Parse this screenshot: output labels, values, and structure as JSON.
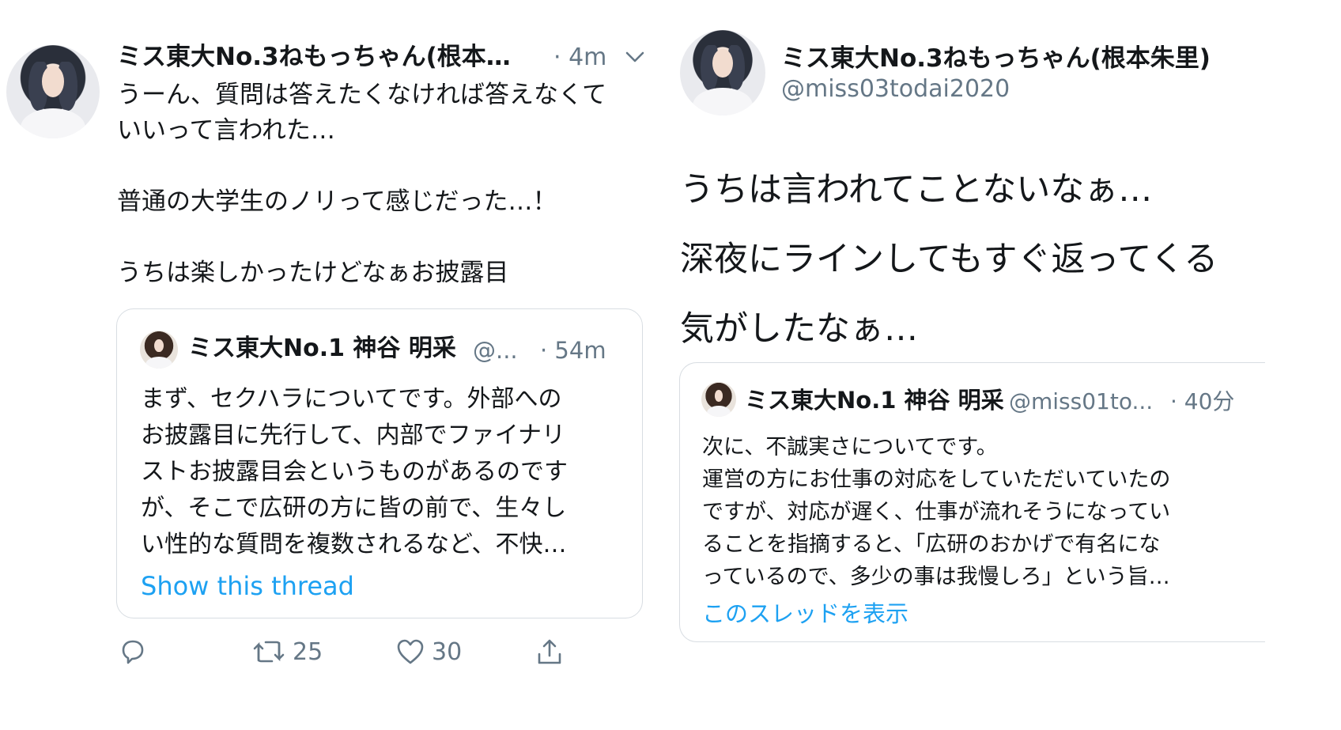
{
  "left_tweet": {
    "author_name": "ミス東大No.3ねもっちゃん(根本…",
    "time": "· 4m",
    "body": "うーん、質問は答えたくなければ答えなくて\nいいって言われた…\n\n普通の大学生のノリって感じだった…！\n\nうちは楽しかったけどなぁお披露目",
    "quoted": {
      "author_name": "ミス東大No.1 神谷 明采",
      "handle": "@...",
      "time": "· 54m",
      "body": "まず、セクハラについてです。外部への\nお披露目に先行して、内部でファイナリ\nストお披露目会というものがあるのです\nが、そこで広研の方に皆の前で、生々し\nい性的な質問を複数されるなど、不快…",
      "link": "Show this thread"
    },
    "actions": {
      "retweet_count": "25",
      "like_count": "30"
    }
  },
  "right_tweet": {
    "author_name": "ミス東大No.3ねもっちゃん(根本朱里)",
    "handle": "@miss03todai2020",
    "body": "うちは言われてことないなぁ…\n深夜にラインしてもすぐ返ってくる\n気がしたなぁ…",
    "quoted": {
      "author_name": "ミス東大No.1 神谷 明采",
      "handle": "@miss01to...",
      "time": "· 40分",
      "body": "次に、不誠実さについてです。\n運営の方にお仕事の対応をしていただいていたの\nですが、対応が遅く、仕事が流れそうになってい\nることを指摘すると、「広研のおかげで有名にな\nっているので、多少の事は我慢しろ」という旨…",
      "link": "このスレッドを表示"
    }
  },
  "colors": {
    "text": "#14171a",
    "muted": "#657786",
    "link": "#1da1f2",
    "border": "#d8dde2"
  },
  "icons": [
    "avatar",
    "chevron-down-icon",
    "reply-icon",
    "retweet-icon",
    "like-icon",
    "share-icon"
  ]
}
